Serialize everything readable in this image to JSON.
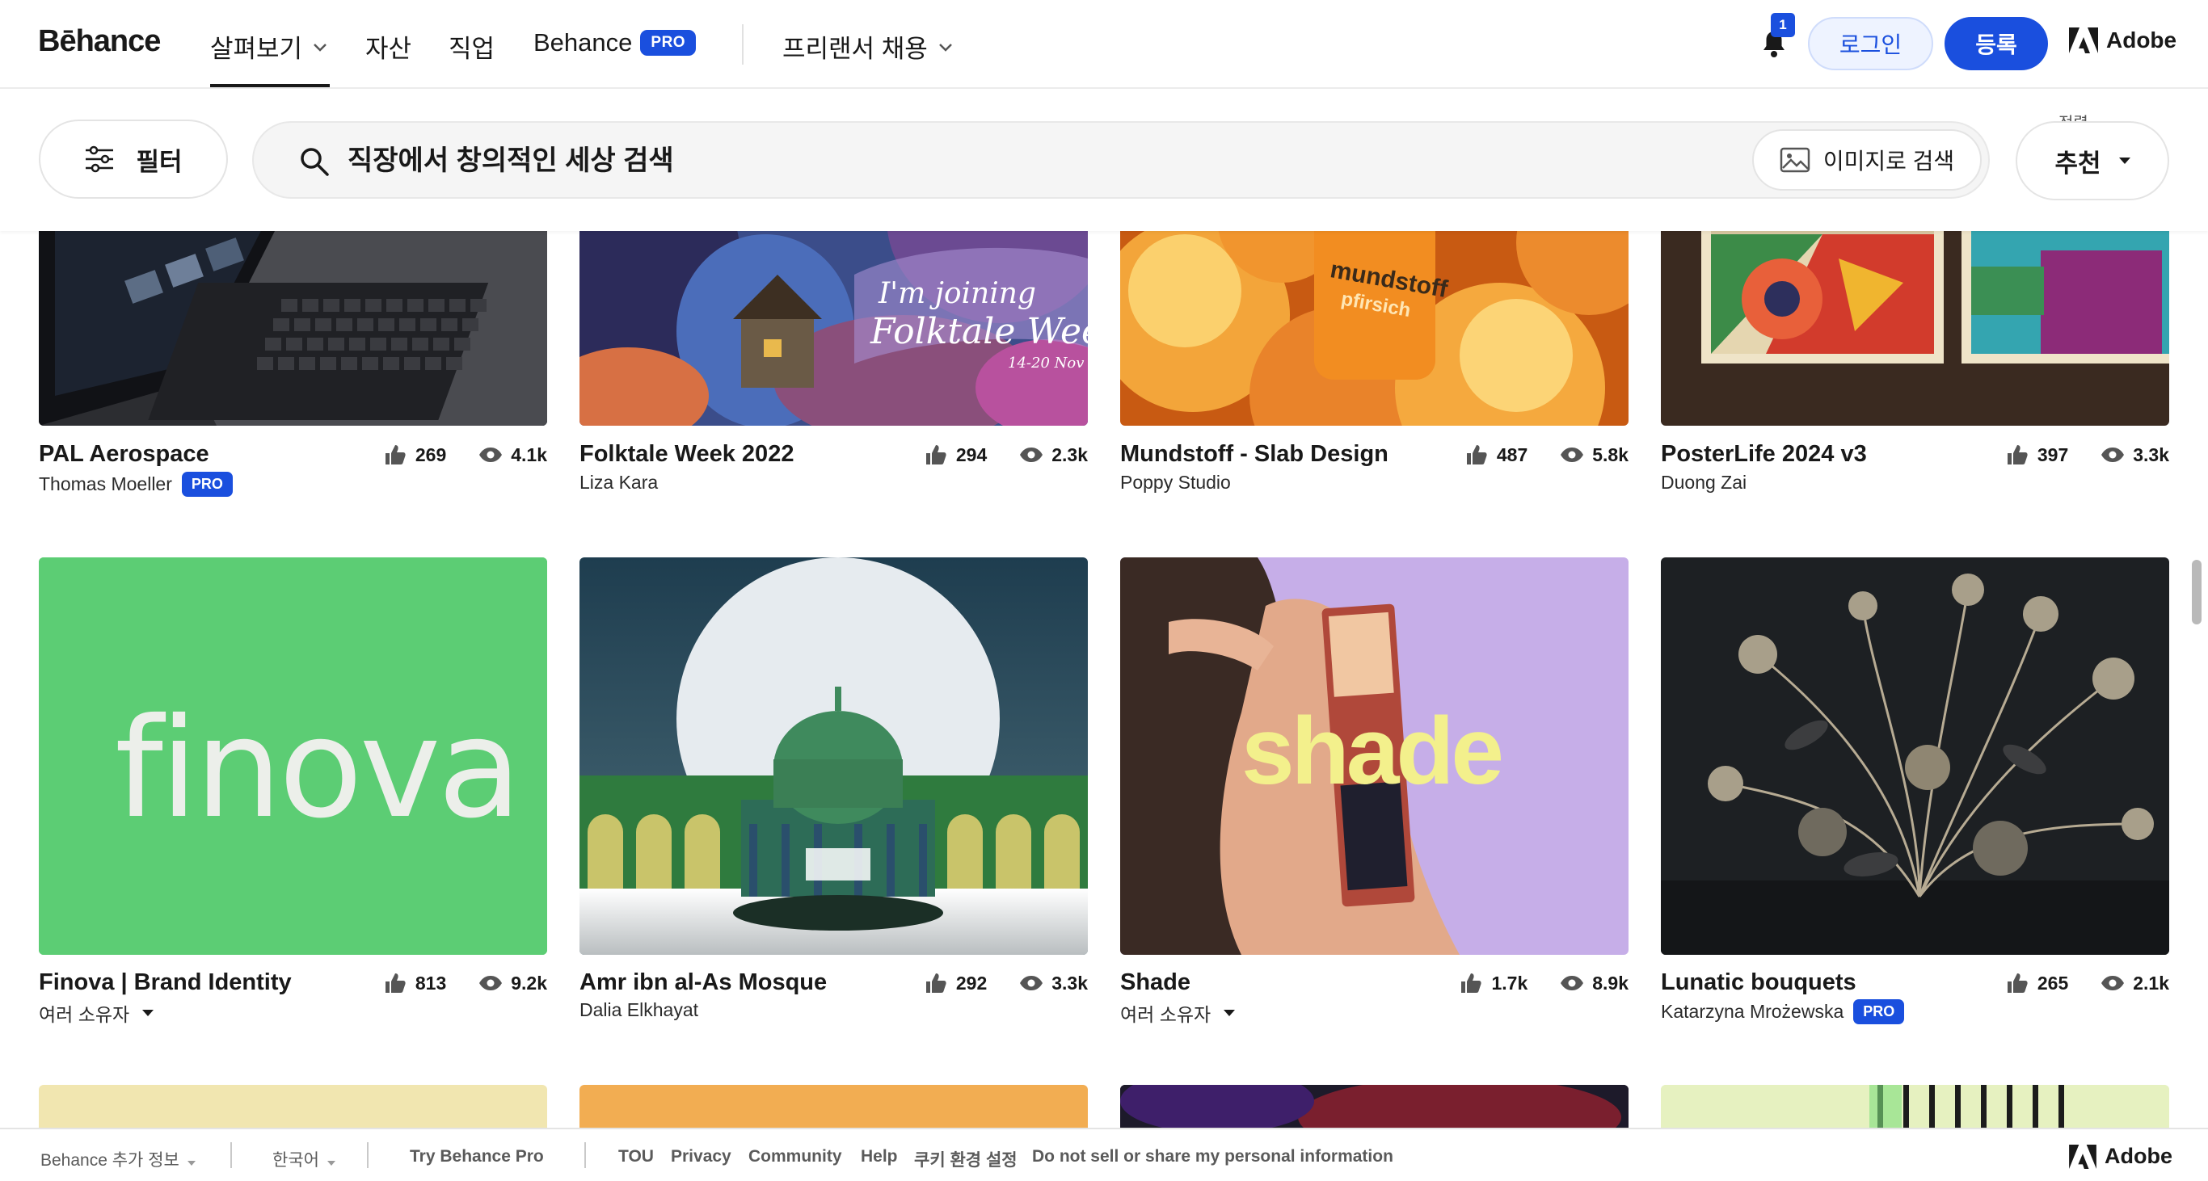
{
  "nav": {
    "logo": "Bēhance",
    "explore": "살펴보기",
    "assets": "자산",
    "jobs": "직업",
    "behance_pro": "Behance",
    "pro_badge": "PRO",
    "hire_freelancer": "프리랜서 채용",
    "notification_count": "1",
    "login": "로그인",
    "signup": "등록",
    "adobe": "Adobe"
  },
  "search": {
    "filter_label": "필터",
    "placeholder": "직장에서 창의적인 세상 검색",
    "image_search": "이미지로 검색",
    "sort_caption": "정렬",
    "sort_value": "추천"
  },
  "projects": [
    {
      "title": "PAL Aerospace",
      "owner": "Thomas Moeller",
      "owner_pro": "PRO",
      "likes": "269",
      "views": "4.1k"
    },
    {
      "title": "Folktale Week 2022",
      "owner": "Liza Kara",
      "owner_pro": "",
      "likes": "294",
      "views": "2.3k",
      "thumb_text_1": "I'm joining",
      "thumb_text_2": "Folktale Week",
      "thumb_text_3": "14-20 Nov"
    },
    {
      "title": "Mundstoff - Slab Design",
      "owner": "Poppy Studio",
      "owner_pro": "",
      "likes": "487",
      "views": "5.8k",
      "thumb_text_1": "mundstoff",
      "thumb_text_2": "pfirsich"
    },
    {
      "title": "PosterLife 2024 v3",
      "owner": "Duong Zai",
      "owner_pro": "",
      "likes": "397",
      "views": "3.3k"
    },
    {
      "title": "Finova | Brand Identity",
      "owner": "여러 소유자",
      "owner_pro": "",
      "likes": "813",
      "views": "9.2k",
      "thumb_text_1": "finova"
    },
    {
      "title": "Amr ibn al-As Mosque",
      "owner": "Dalia Elkhayat",
      "owner_pro": "",
      "likes": "292",
      "views": "3.3k"
    },
    {
      "title": "Shade",
      "owner": "여러 소유자",
      "owner_pro": "",
      "likes": "1.7k",
      "views": "8.9k",
      "thumb_text_1": "shade"
    },
    {
      "title": "Lunatic bouquets",
      "owner": "Katarzyna Mrożewska",
      "owner_pro": "PRO",
      "likes": "265",
      "views": "2.1k"
    }
  ],
  "footer": {
    "more_info": "Behance 추가 정보",
    "language": "한국어",
    "try_pro": "Try Behance Pro",
    "tou": "TOU",
    "privacy": "Privacy",
    "community": "Community",
    "help": "Help",
    "cookie": "쿠키 환경 설정",
    "do_not_sell": "Do not sell or share my personal information",
    "adobe": "Adobe"
  }
}
